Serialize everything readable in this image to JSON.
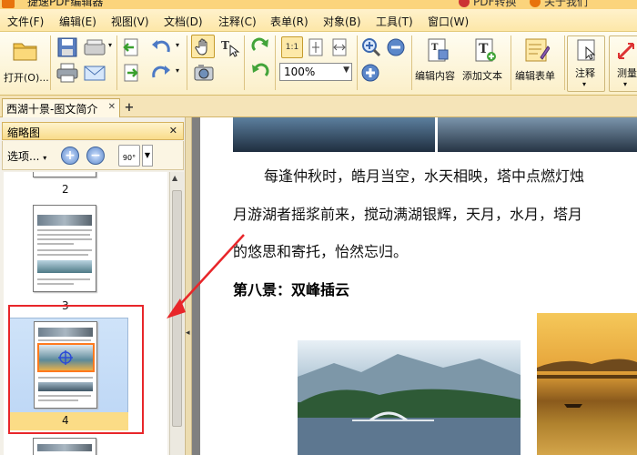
{
  "titlebar": {
    "title": "捷速PDF编辑器",
    "right_a": "PDF转换",
    "right_b": "关于我们"
  },
  "menu": [
    "文件(F)",
    "编辑(E)",
    "视图(V)",
    "文档(D)",
    "注释(C)",
    "表单(R)",
    "对象(B)",
    "工具(T)",
    "窗口(W)"
  ],
  "toolbar": {
    "open_label": "打开(O)...",
    "zoom_value": "100%",
    "zoom_fit_label": "1:1",
    "edit_content_label": "编辑内容",
    "add_text_label": "添加文本",
    "edit_form_label": "编辑表单",
    "annotate_label": "注释",
    "measure_label": "测量"
  },
  "tabs": [
    {
      "label": "西湖十景-图文简介"
    }
  ],
  "thumbnail_panel": {
    "title": "缩略图",
    "options_label": "选项...",
    "rotate_label": "90°",
    "pages": [
      {
        "number": "2",
        "selected": false
      },
      {
        "number": "3",
        "selected": false
      },
      {
        "number": "4",
        "selected": true
      }
    ]
  },
  "document": {
    "para1": "每逢仲秋时，皓月当空，水天相映，塔中点燃灯烛",
    "para2": "月游湖者摇浆前来，搅动满湖银辉，天月，水月，塔月",
    "para3": "的悠思和寄托，怡然忘归。",
    "heading": "第八景：双峰插云"
  },
  "colors": {
    "accent": "#fbd47c",
    "annotation_red": "#e8262a",
    "selection_blue": "#cfe3f9"
  }
}
